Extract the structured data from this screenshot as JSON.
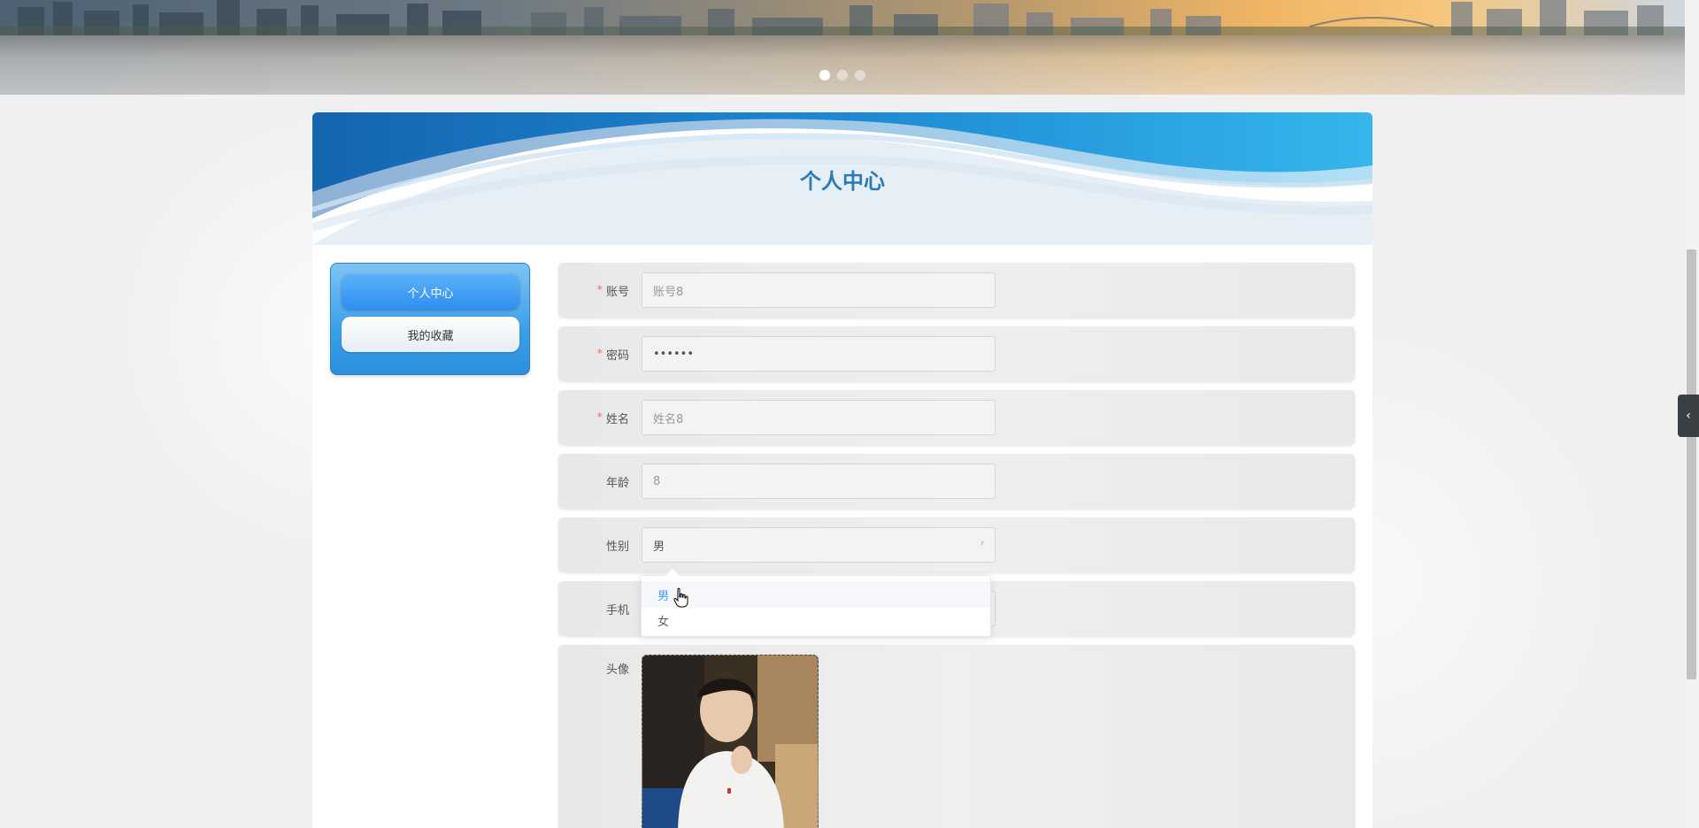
{
  "banner": {
    "slides": 3,
    "active_slide": 1
  },
  "card": {
    "title": "个人中心"
  },
  "menu": {
    "items": [
      {
        "label": "个人中心",
        "active": true
      },
      {
        "label": "我的收藏",
        "active": false
      }
    ]
  },
  "form": {
    "account": {
      "label": "账号",
      "required": true,
      "value": "账号8"
    },
    "password": {
      "label": "密码",
      "required": true,
      "value": "••••••"
    },
    "name": {
      "label": "姓名",
      "required": true,
      "value": "姓名8"
    },
    "age": {
      "label": "年龄",
      "required": false,
      "value": "8"
    },
    "gender": {
      "label": "性别",
      "required": false,
      "value": "男",
      "options": [
        "男",
        "女"
      ]
    },
    "phone": {
      "label": "手机",
      "required": false
    },
    "avatar": {
      "label": "头像",
      "required": false
    }
  },
  "colors": {
    "accent": "#409eff",
    "title": "#2a7bb8",
    "required": "#f56c6c",
    "menu_active": "#2f8ff0"
  }
}
